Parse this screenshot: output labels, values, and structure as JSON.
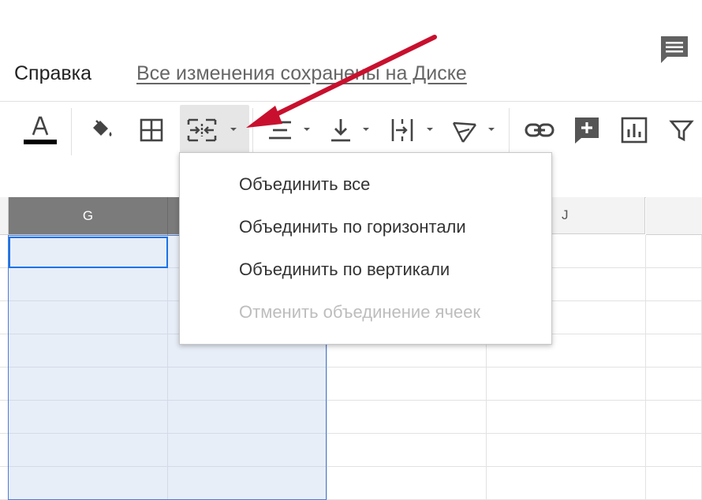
{
  "menubar": {
    "help_label": "Справка",
    "save_status": "Все изменения сохранены на Диске"
  },
  "toolbar": {
    "text_color_icon": "text-color-icon",
    "text_color_swatch": "#000000",
    "fill_color_icon": "paint-bucket-icon",
    "borders_icon": "borders-icon",
    "merge_icon": "merge-cells-icon",
    "halign_icon": "align-center-icon",
    "valign_icon": "valign-bottom-icon",
    "wrap_icon": "text-wrap-icon",
    "rotate_icon": "text-rotate-icon",
    "link_icon": "link-icon",
    "comment_icon": "add-comment-icon",
    "chart_icon": "chart-icon",
    "filter_icon": "filter-icon"
  },
  "grid": {
    "columns": [
      "G",
      "",
      "",
      "J",
      ""
    ]
  },
  "merge_menu": {
    "items": [
      {
        "label": "Объединить все",
        "enabled": true
      },
      {
        "label": "Объединить по горизонтали",
        "enabled": true
      },
      {
        "label": "Объединить по вертикали",
        "enabled": true
      },
      {
        "label": "Отменить объединение ячеек",
        "enabled": false
      }
    ]
  },
  "colors": {
    "selection": "#e8eef8",
    "accent": "#1a73e8",
    "arrow": "#d32f2f"
  }
}
